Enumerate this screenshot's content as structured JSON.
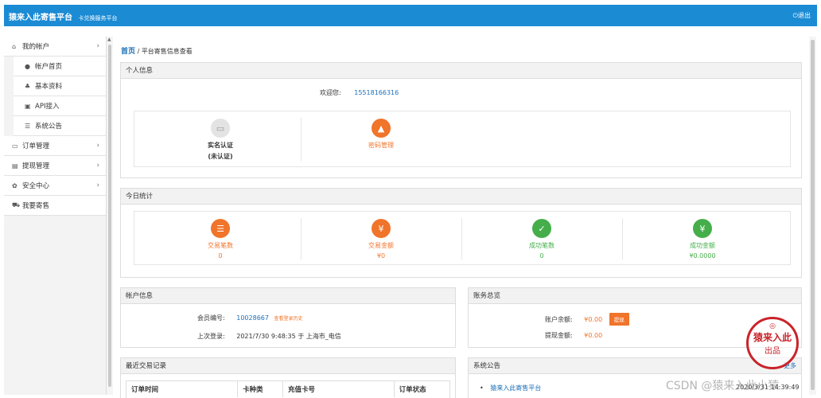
{
  "header": {
    "title": "猿来入此寄售平台",
    "subtitle": "卡兑换服务平台",
    "logout_label": "退出"
  },
  "sidebar": {
    "items": [
      {
        "label": "我的帐户",
        "icon": "home-icon",
        "expanded": true
      },
      {
        "label": "帐户首页",
        "icon": "user-icon"
      },
      {
        "label": "基本资料",
        "icon": "sitemap-icon"
      },
      {
        "label": "API接入",
        "icon": "lock-icon"
      },
      {
        "label": "系统公告",
        "icon": "list-icon"
      },
      {
        "label": "订单管理",
        "icon": "card-icon"
      },
      {
        "label": "提现管理",
        "icon": "credit-card-icon"
      },
      {
        "label": "安全中心",
        "icon": "gear-icon"
      },
      {
        "label": "我要寄售",
        "icon": "cart-icon"
      }
    ]
  },
  "breadcrumb": {
    "home": "首页",
    "current": "平台寄售信息查看"
  },
  "personal": {
    "title": "个人信息",
    "welcome_label": "欢迎您:",
    "username": "15518166316",
    "realname_title": "实名认证",
    "realname_status": "(未认证)",
    "password_label": "密码管理"
  },
  "today": {
    "title": "今日统计",
    "stats": [
      {
        "label": "交易笔数",
        "value": "0",
        "icon": "table-icon"
      },
      {
        "label": "交易金额",
        "value": "¥0",
        "icon": "yen-icon"
      },
      {
        "label": "成功笔数",
        "value": "0",
        "icon": "check-icon"
      },
      {
        "label": "成功金额",
        "value": "¥0.0000",
        "icon": "yen-icon"
      }
    ]
  },
  "account": {
    "title": "帐户信息",
    "member_label": "会员编号:",
    "member_id": "10028667",
    "login_history": "查看登录历史",
    "last_login_label": "上次登录:",
    "last_login_value": "2021/7/30 9:48:35 于 上海市_电信"
  },
  "finance": {
    "title": "账务总览",
    "balance_label": "账户余额:",
    "balance_value": "¥0.00",
    "withdraw_button": "提现",
    "withdrawn_label": "提现金额:",
    "withdrawn_value": "¥0.00"
  },
  "recent": {
    "title": "最近交易记录",
    "columns": [
      "订单时间",
      "卡种类",
      "充值卡号",
      "订单状态"
    ]
  },
  "notice": {
    "title": "系统公告",
    "items": [
      "猿来入此寄售平台"
    ],
    "more": "更多",
    "date": "2020/3/31 14:39:49"
  },
  "overlay": {
    "watermark": "CSDN @猿来入此小猿",
    "seal_line1": "猿来入此",
    "seal_line2": "出品"
  },
  "colors": {
    "primary": "#1b8bd4",
    "accent": "#f0742a",
    "success": "#45ae4a"
  }
}
